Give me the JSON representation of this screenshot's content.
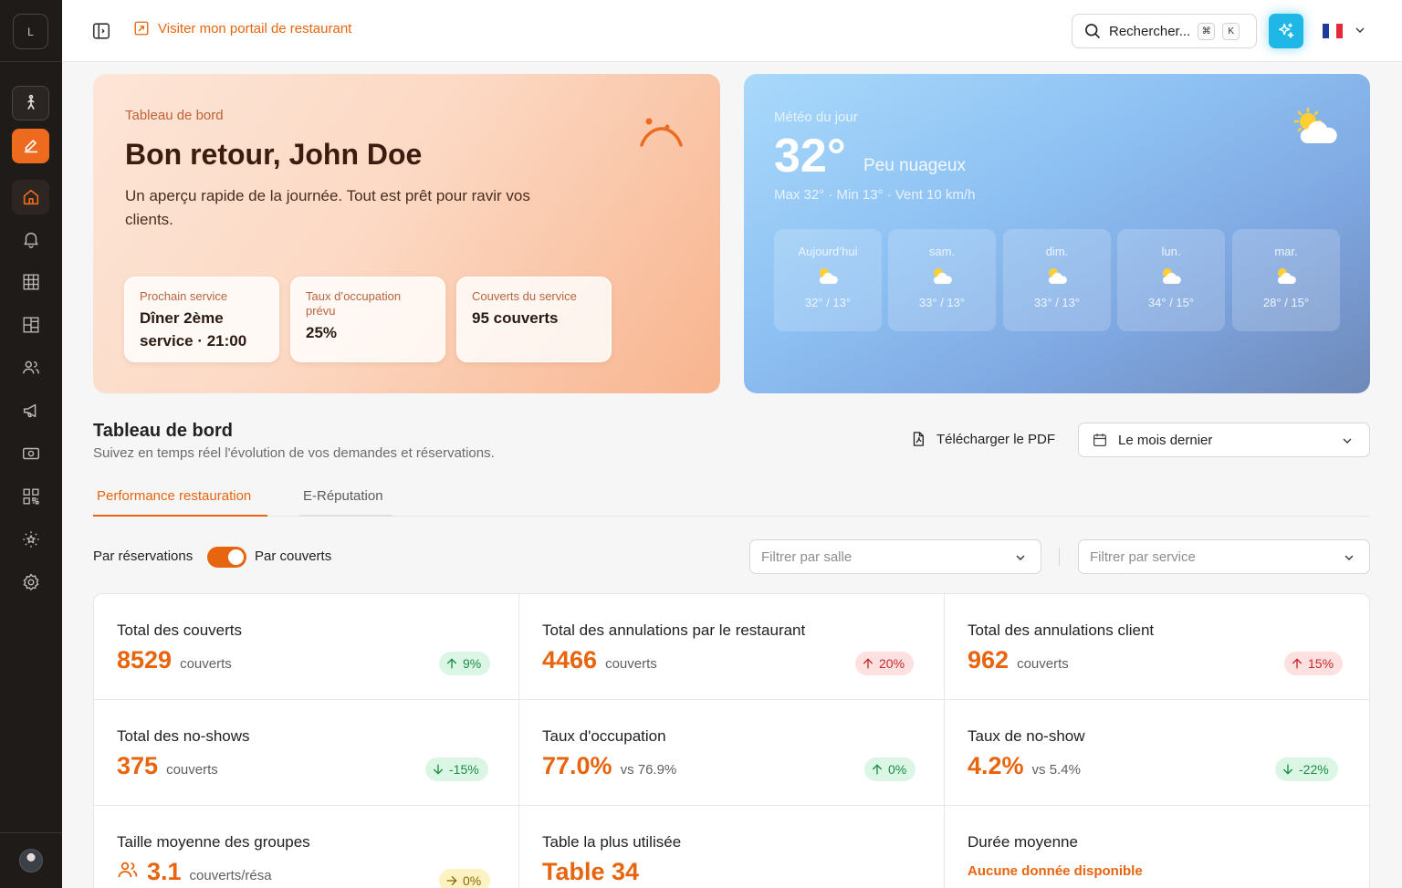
{
  "sidebar": {
    "logo_letter": "L",
    "items": [
      {
        "name": "walk-icon"
      },
      {
        "name": "edit-icon"
      },
      {
        "name": "home-icon"
      },
      {
        "name": "bell-icon"
      },
      {
        "name": "grid-icon"
      },
      {
        "name": "layout-icon"
      },
      {
        "name": "users-icon"
      },
      {
        "name": "megaphone-icon"
      },
      {
        "name": "cash-icon"
      },
      {
        "name": "qrcode-icon"
      },
      {
        "name": "sparkle-star-icon"
      },
      {
        "name": "settings-icon"
      }
    ]
  },
  "topbar": {
    "portal_link": "Visiter mon portail de restaurant",
    "search_placeholder": "Rechercher...",
    "kbd_cmd": "⌘",
    "kbd_k": "K"
  },
  "welcome": {
    "kicker": "Tableau de bord",
    "title": "Bon retour, John Doe",
    "description": "Un aperçu rapide de la journée. Tout est prêt pour ravir vos clients.",
    "stats": [
      {
        "label": "Prochain service",
        "value": "Dîner 2ème service · 21:00"
      },
      {
        "label": "Taux d’occupation prévu",
        "value": "25%"
      },
      {
        "label": "Couverts du service",
        "value": "95 couverts"
      }
    ]
  },
  "weather": {
    "kicker": "Météo du jour",
    "temp": "32°",
    "condition": "Peu nuageux",
    "meta": "Max 32° · Min 13° · Vent 10 km/h",
    "days": [
      {
        "day": "Aujourd’hui",
        "range": "32° / 13°"
      },
      {
        "day": "sam.",
        "range": "33° / 13°"
      },
      {
        "day": "dim.",
        "range": "33° / 13°"
      },
      {
        "day": "lun.",
        "range": "34° / 15°"
      },
      {
        "day": "mar.",
        "range": "28° / 15°"
      }
    ]
  },
  "dashboard": {
    "title": "Tableau de bord",
    "subtitle": "Suivez en temps réel l'évolution de vos demandes et réservations.",
    "pdf_label": "Télécharger le PDF",
    "period": "Le mois dernier",
    "tabs": [
      {
        "label": "Performance restauration",
        "active": true
      },
      {
        "label": "E-Réputation",
        "active": false
      }
    ],
    "toggle_left": "Par réservations",
    "toggle_right": "Par couverts",
    "toggle_on": true,
    "filter_room_placeholder": "Filtrer par salle",
    "filter_service_placeholder": "Filtrer par service"
  },
  "kpis": [
    {
      "title": "Total des couverts",
      "value": "8529",
      "unit": "couverts",
      "badge": "9%",
      "trend": "up",
      "tone": "green"
    },
    {
      "title": "Total des annulations par le restaurant",
      "value": "4466",
      "unit": "couverts",
      "badge": "20%",
      "trend": "up",
      "tone": "red"
    },
    {
      "title": "Total des annulations client",
      "value": "962",
      "unit": "couverts",
      "badge": "15%",
      "trend": "up",
      "tone": "red"
    },
    {
      "title": "Total des no-shows",
      "value": "375",
      "unit": "couverts",
      "badge": "-15%",
      "trend": "down",
      "tone": "green"
    },
    {
      "title": "Taux d'occupation",
      "value": "77.0%",
      "unit": "vs 76.9%",
      "badge": "0%",
      "trend": "up",
      "tone": "green"
    },
    {
      "title": "Taux de no-show",
      "value": "4.2%",
      "unit": "vs 5.4%",
      "badge": "-22%",
      "trend": "down",
      "tone": "green"
    },
    {
      "title": "Taille moyenne des groupes",
      "value": "3.1",
      "unit": "couverts/résa",
      "badge": "0%",
      "trend": "flat",
      "tone": "yellow"
    },
    {
      "title": "Table la plus utilisée",
      "value": "Table 34",
      "unit": "",
      "badge": "",
      "trend": "",
      "tone": ""
    },
    {
      "title": "Durée moyenne",
      "value": "",
      "unit": "",
      "empty_text": "Aucune donnée disponible",
      "badge": "",
      "trend": "",
      "tone": ""
    }
  ],
  "colors": {
    "accent": "#e8650f",
    "sidebar": "#1f1b19",
    "ai_button": "#1fb7e6"
  }
}
